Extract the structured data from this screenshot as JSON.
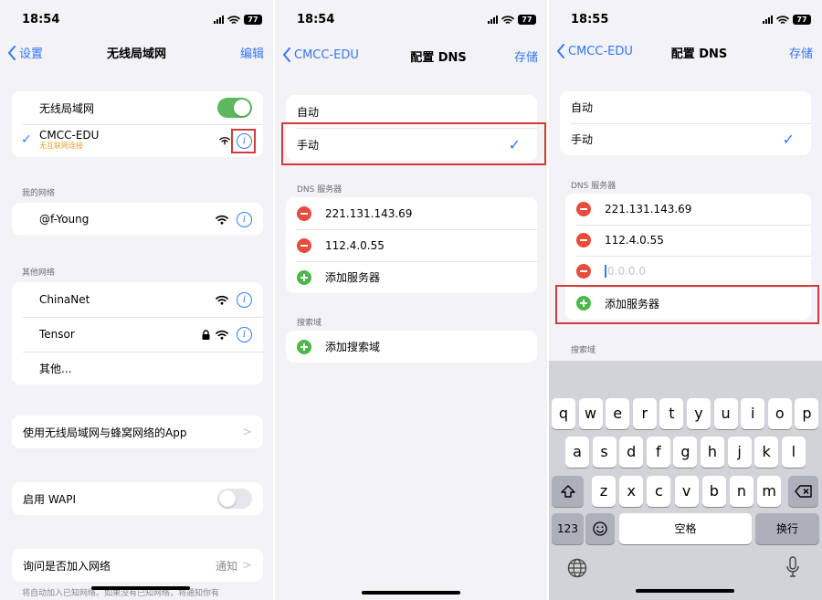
{
  "panel1": {
    "status": {
      "time": "18:54",
      "battery": "77"
    },
    "nav": {
      "back": "设置",
      "title": "无线局域网",
      "action": "编辑"
    },
    "wlan": {
      "label": "无线局域网",
      "toggle": "on"
    },
    "current": {
      "name": "CMCC-EDU",
      "subtitle": "无互联网连接"
    },
    "my_networks_label": "我的网络",
    "my_networks": [
      {
        "name": "@f-Young"
      }
    ],
    "other_networks_label": "其他网络",
    "other_networks": [
      {
        "name": "ChinaNet"
      },
      {
        "name": "Tensor"
      },
      {
        "name": "其他..."
      }
    ],
    "apps_row": "使用无线局域网与蜂窝网络的App",
    "wapi_row": "启用 WAPI",
    "ask_row": {
      "label": "询问是否加入网络",
      "value": "通知"
    },
    "footer": "将自动加入已知网络。如果没有已知网络，将通知你有"
  },
  "panel2": {
    "status": {
      "time": "18:54",
      "battery": "77"
    },
    "nav": {
      "back": "CMCC-EDU",
      "title": "配置 DNS",
      "action": "存储"
    },
    "modes": [
      "自动",
      "手动"
    ],
    "dns_label": "DNS 服务器",
    "servers": [
      "221.131.143.69",
      "112.4.0.55"
    ],
    "add_server": "添加服务器",
    "search_label": "搜索域",
    "add_search": "添加搜索域"
  },
  "panel3": {
    "status": {
      "time": "18:55",
      "battery": "77"
    },
    "nav": {
      "back": "CMCC-EDU",
      "title": "配置 DNS",
      "action": "存储"
    },
    "modes": [
      "自动",
      "手动"
    ],
    "dns_label": "DNS 服务器",
    "servers": [
      "221.131.143.69",
      "112.4.0.55"
    ],
    "new_server_placeholder": "0.0.0.0",
    "add_server": "添加服务器",
    "search_label": "搜索域",
    "keyboard": {
      "row1": [
        "q",
        "w",
        "e",
        "r",
        "t",
        "y",
        "u",
        "i",
        "o",
        "p"
      ],
      "row2": [
        "a",
        "s",
        "d",
        "f",
        "g",
        "h",
        "j",
        "k",
        "l"
      ],
      "row3": [
        "z",
        "x",
        "c",
        "v",
        "b",
        "n",
        "m"
      ],
      "num_key": "123",
      "space_key": "空格",
      "return_key": "换行"
    }
  },
  "colors": {
    "accent": "#3478f6",
    "toggle_on": "#5cb85c",
    "delete": "#e74c3c",
    "add": "#4cb849",
    "highlight": "#d33a3a"
  },
  "icons": [
    "chevron-left-icon",
    "info-icon",
    "wifi-icon",
    "lock-icon",
    "checkmark-icon",
    "minus-circle-icon",
    "plus-circle-icon",
    "shift-icon",
    "delete-key-icon",
    "emoji-icon",
    "globe-icon",
    "microphone-icon"
  ]
}
